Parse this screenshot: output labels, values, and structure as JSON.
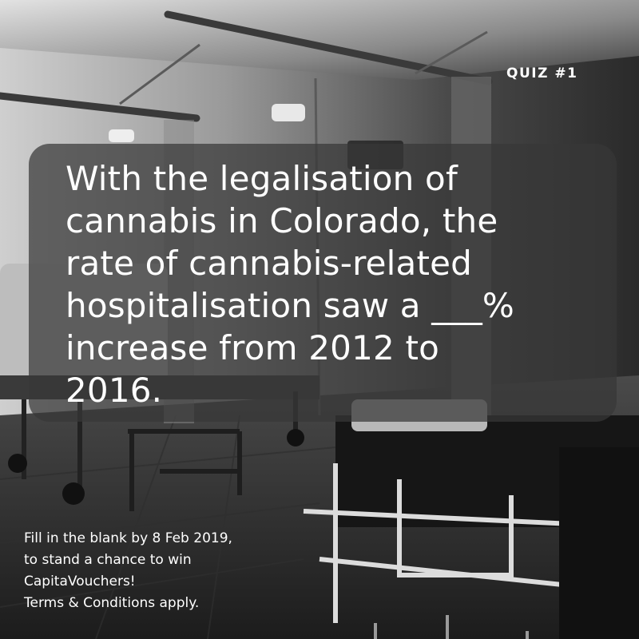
{
  "quiz_label": "QUIZ #1",
  "question_lines": [
    "With the legalisation of",
    "cannabis in Colorado, the",
    "rate of cannabis-related",
    "hospitalisation saw a ___%",
    "increase from 2012 to",
    "2016."
  ],
  "footer_lines": [
    "Fill in the blank by 8 Feb 2019,",
    "to stand a chance to win",
    "CapitaVouchers!",
    "Terms & Conditions apply."
  ]
}
